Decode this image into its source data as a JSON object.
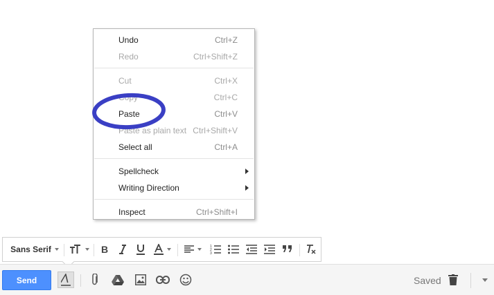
{
  "context_menu": {
    "items": [
      {
        "label": "Undo",
        "shortcut": "Ctrl+Z",
        "disabled": false
      },
      {
        "label": "Redo",
        "shortcut": "Ctrl+Shift+Z",
        "disabled": true
      },
      {
        "label": "Cut",
        "shortcut": "Ctrl+X",
        "disabled": true
      },
      {
        "label": "Copy",
        "shortcut": "Ctrl+C",
        "disabled": true
      },
      {
        "label": "Paste",
        "shortcut": "Ctrl+V",
        "disabled": false
      },
      {
        "label": "Paste as plain text",
        "shortcut": "Ctrl+Shift+V",
        "disabled": true
      },
      {
        "label": "Select all",
        "shortcut": "Ctrl+A",
        "disabled": false
      },
      {
        "label": "Spellcheck",
        "submenu": true
      },
      {
        "label": "Writing Direction",
        "submenu": true
      },
      {
        "label": "Inspect",
        "shortcut": "Ctrl+Shift+I",
        "disabled": false
      }
    ]
  },
  "annotation": {
    "color": "#3a3fc4",
    "target": "Paste"
  },
  "format_toolbar": {
    "font": "Sans Serif",
    "icons": [
      "font-size-icon",
      "bold-icon",
      "italic-icon",
      "underline-icon",
      "text-color-icon",
      "align-icon",
      "numbered-list-icon",
      "bulleted-list-icon",
      "indent-less-icon",
      "indent-more-icon",
      "quote-icon",
      "remove-formatting-icon"
    ]
  },
  "compose_bar": {
    "send_label": "Send",
    "saved_label": "Saved",
    "icons": [
      "formatting-options-icon",
      "attach-icon",
      "drive-icon",
      "photo-icon",
      "link-icon",
      "emoji-icon",
      "trash-icon",
      "more-options-icon"
    ],
    "colors": {
      "send": "#4d90fe"
    }
  }
}
